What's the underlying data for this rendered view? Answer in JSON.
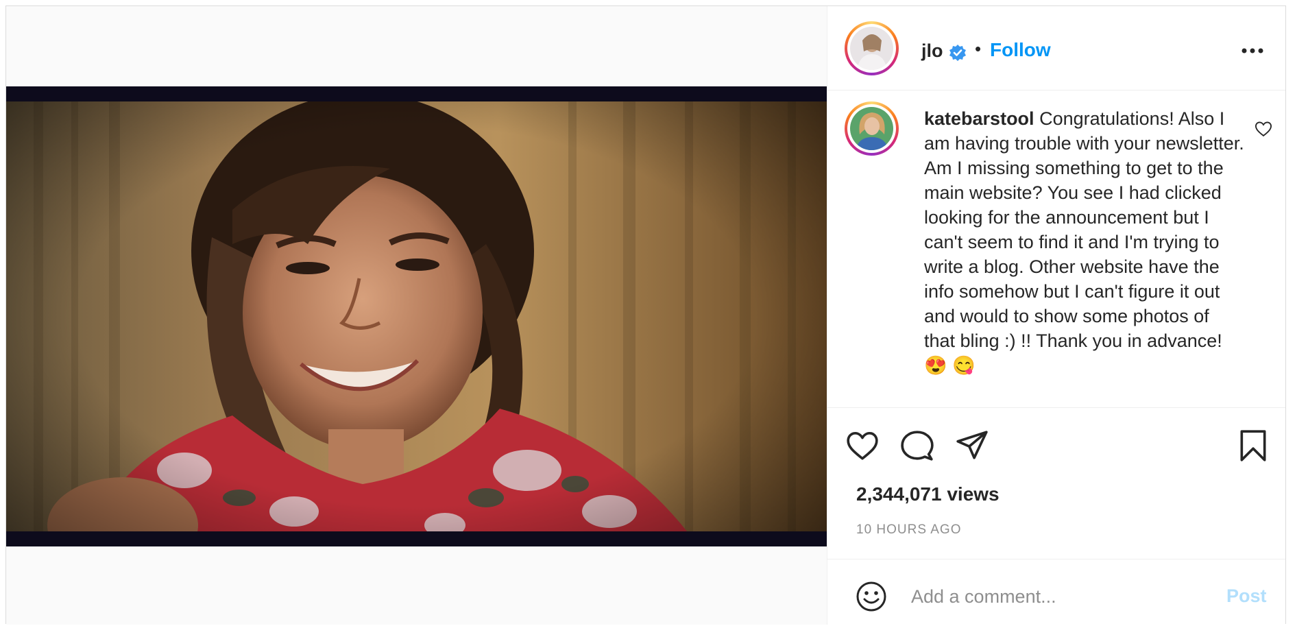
{
  "post": {
    "author": {
      "username": "jlo",
      "verified": true,
      "follow_label": "Follow",
      "separator": "•"
    },
    "comment": {
      "username": "katebarstool",
      "text": "Congratulations! Also I am having trouble with your newsletter. Am I missing something to get to the main website? You see I had clicked looking for the announcement but I can't seem to find it and I'm trying to write a blog. Other website have the info somehow but I can't figure it out and would to show some photos of that bling :) !! Thank you in advance! 😍 😋"
    },
    "views": "2,344,071 views",
    "time_ago": "10 HOURS AGO",
    "add_comment": {
      "placeholder": "Add a comment...",
      "post_label": "Post"
    }
  },
  "icons": {
    "verified": "verified-badge-icon",
    "more": "more-options-icon",
    "comment_like": "heart-outline-icon",
    "like": "heart-icon",
    "comment": "comment-bubble-icon",
    "share": "paper-plane-icon",
    "save": "bookmark-icon",
    "emoji": "emoji-smile-icon"
  },
  "colors": {
    "accent": "#0095f6",
    "post_disabled": "#b2dffc",
    "muted": "#8e8e8e",
    "text": "#262626"
  }
}
